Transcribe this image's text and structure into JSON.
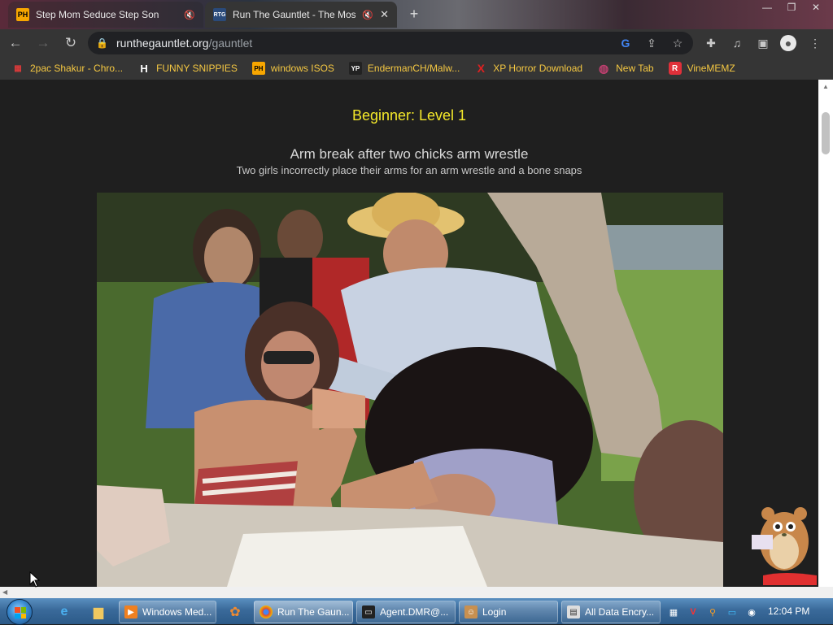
{
  "tabs": [
    {
      "title": "Step Mom Seduce Step Son",
      "favicon": "PH",
      "active": false,
      "muted": true
    },
    {
      "title": "Run The Gauntlet - The Mos",
      "favicon": "RTG",
      "active": true,
      "muted": true
    }
  ],
  "address": {
    "host": "runthegauntlet.org",
    "path": "/gauntlet"
  },
  "bookmarks": [
    {
      "label": "2pac Shakur - Chro...",
      "icon": "bookmark-icon-calendar",
      "color": "#d83a3a",
      "glyph": "▦"
    },
    {
      "label": "FUNNY SNIPPIES",
      "icon": "h-icon",
      "color": "#ffffff",
      "glyph": "H"
    },
    {
      "label": "windows ISOS",
      "icon": "ph-icon",
      "color": "#f7a600",
      "glyph": "PH"
    },
    {
      "label": "EndermanCH/Malw...",
      "icon": "yp-icon",
      "color": "#333333",
      "glyph": "YP"
    },
    {
      "label": "XP Horror Download",
      "icon": "x-icon",
      "color": "#e02020",
      "glyph": "X"
    },
    {
      "label": "New Tab",
      "icon": "globe-icon",
      "color": "#b03060",
      "glyph": "◍"
    },
    {
      "label": "VineMEMZ",
      "icon": "r-icon",
      "color": "#e0303a",
      "glyph": "R"
    }
  ],
  "page": {
    "level": "Beginner: Level 1",
    "video_title": "Arm break after two chicks arm wrestle",
    "video_subtitle": "Two girls incorrectly place their arms for an arm wrestle and a bone snaps"
  },
  "taskbar": {
    "buttons": [
      {
        "label": "Windows Med...",
        "icon": "media-player-icon"
      },
      {
        "label": "Run The Gaun...",
        "icon": "chrome-icon"
      },
      {
        "label": "Agent.DMR@...",
        "icon": "terminal-icon"
      },
      {
        "label": "Login",
        "icon": "login-icon"
      },
      {
        "label": "All Data Encry...",
        "icon": "window-icon"
      }
    ],
    "clock": "12:04 PM"
  }
}
